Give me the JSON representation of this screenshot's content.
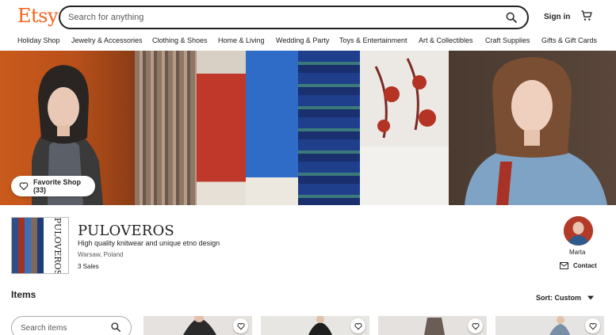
{
  "header": {
    "logo": "Etsy",
    "search_placeholder": "Search for anything",
    "signin_label": "Sign in"
  },
  "nav": [
    "Holiday Shop",
    "Jewelry & Accessories",
    "Clothing & Shoes",
    "Home & Living",
    "Wedding & Party",
    "Toys & Entertainment",
    "Art & Collectibles",
    "Craft Supplies",
    "Gifts & Gift Cards"
  ],
  "banner": {
    "favorite_label": "Favorite Shop (33)"
  },
  "shop": {
    "name": "PULOVEROS",
    "thumb_text": "PULOVEROS",
    "tagline": "High quality knitwear and unique etno design",
    "location": "Warsaw, Poland",
    "sales": "3 Sales"
  },
  "owner": {
    "name": "Marta",
    "contact_label": "Contact"
  },
  "items": {
    "title": "Items",
    "sort_label": "Sort: Custom",
    "search_placeholder": "Search items"
  },
  "colors": {
    "brand": "#F1641E",
    "text": "#222222"
  }
}
